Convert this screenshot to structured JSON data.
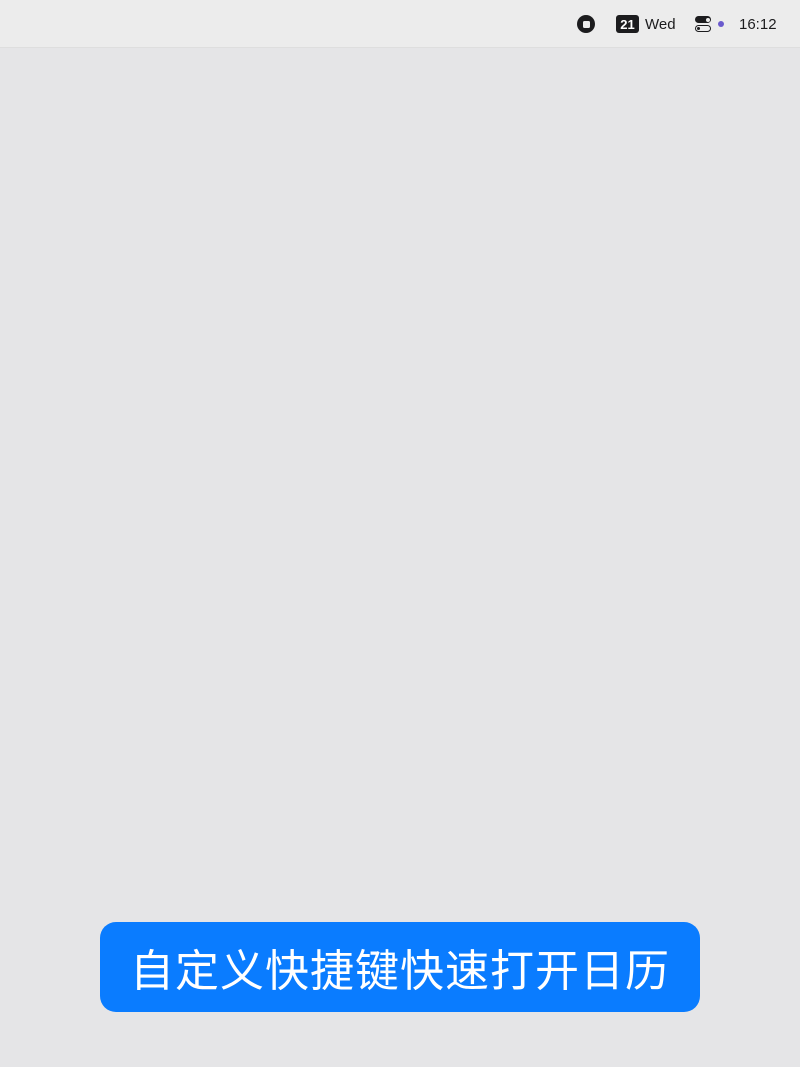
{
  "menubar": {
    "stop_icon": "stop-circle-icon",
    "date_day": "21",
    "weekday": "Wed",
    "control_center_icon": "control-center-toggles-icon",
    "status_dot_color": "#6a5acd",
    "clock": "16:12"
  },
  "caption": {
    "text": "自定义快捷键快速打开日历",
    "background": "#0a7cff"
  }
}
